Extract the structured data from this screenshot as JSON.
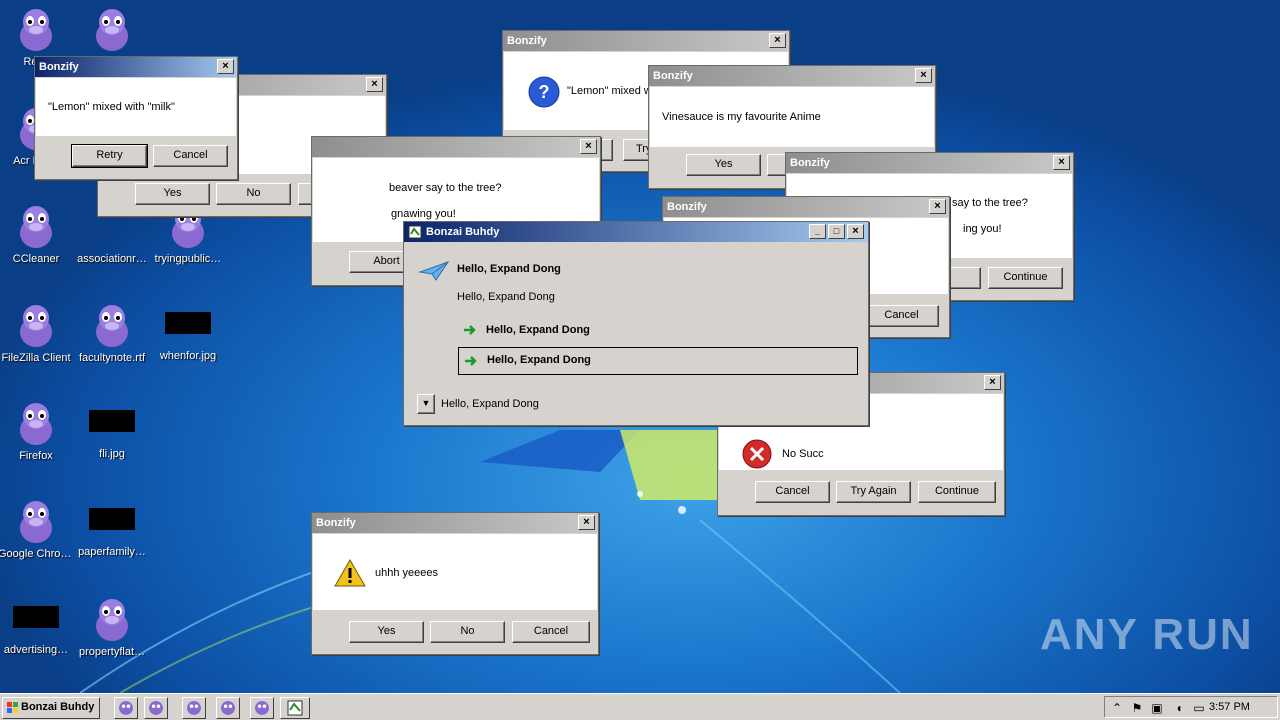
{
  "desktop_icons": [
    {
      "label": "Recy",
      "kind": "bonzi"
    },
    {
      "label": "",
      "kind": "bonzi"
    },
    {
      "label": "Acr Read",
      "kind": "bonzi"
    },
    {
      "label": "CCleaner",
      "kind": "bonzi"
    },
    {
      "label": "associationr…",
      "kind": "none"
    },
    {
      "label": "tryingpublic…",
      "kind": "bonzi"
    },
    {
      "label": "FileZilla Client",
      "kind": "bonzi"
    },
    {
      "label": "facultynote.rtf",
      "kind": "bonzi"
    },
    {
      "label": "whenfor.jpg",
      "kind": "black"
    },
    {
      "label": "Firefox",
      "kind": "bonzi"
    },
    {
      "label": "fli.jpg",
      "kind": "black"
    },
    {
      "label": "Google Chrome",
      "kind": "bonzi"
    },
    {
      "label": "paperfamily…",
      "kind": "black"
    },
    {
      "label": "advertising…",
      "kind": "black"
    },
    {
      "label": "propertyflat…",
      "kind": "bonzi"
    }
  ],
  "dialogs": {
    "d1": {
      "title": "Bonzify",
      "message": "\"Lemon\" mixed with \"milk\"",
      "btn1": "Retry",
      "btn2": "Cancel"
    },
    "d2": {
      "btn1": "Yes",
      "btn2": "No",
      "btn3": "Cancel"
    },
    "d3": {
      "msg1": "beaver say to the tree?",
      "msg2": "gnawing you!",
      "btn1": "Abort"
    },
    "d4": {
      "title": "Bonzify",
      "message": "\"Lemon\" mixed w",
      "btn2": "Try"
    },
    "d5": {
      "title": "Bonzify",
      "message": "Vinesauce is my favourite Anime",
      "btn1": "Yes"
    },
    "d6": {
      "title": "Bonzify",
      "message": "say to the tree?",
      "msg2": "ing you!",
      "btn1": "ain",
      "btn2": "Continue"
    },
    "d7": {
      "title": "Bonzify",
      "btn1": "Cancel"
    },
    "d8": {
      "message": "No Succ",
      "btn1": "Cancel",
      "btn2": "Try Again",
      "btn3": "Continue"
    },
    "d9": {
      "title": "Bonzify",
      "message": "uhhh yeeees",
      "btn1": "Yes",
      "btn2": "No",
      "btn3": "Cancel"
    }
  },
  "main_dialog": {
    "title": "Bonzai Buhdy",
    "heading": "Hello, Expand Dong",
    "subtext": "Hello, Expand Dong",
    "option1": "Hello, Expand Dong",
    "option2": "Hello, Expand Dong",
    "footer": "Hello, Expand Dong"
  },
  "taskbar": {
    "start_label": "Bonzai Buhdy",
    "clock": "3:57 PM"
  },
  "watermark": "ANY RUN",
  "colors": {
    "desktop": "#1a76cc",
    "window_face": "#d6d3ce",
    "title_inactive": "#8e8e8e",
    "title_active": "#0a246a"
  }
}
